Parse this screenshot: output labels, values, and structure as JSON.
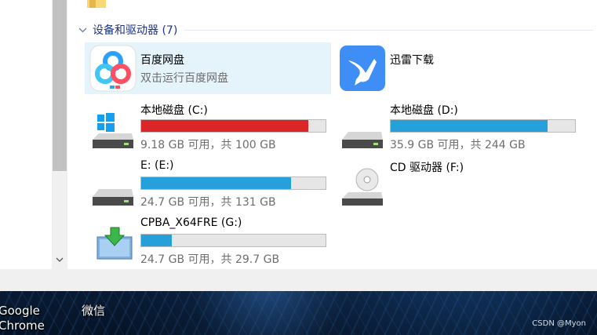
{
  "desktop": {
    "icons": [
      {
        "label_line1": "Google",
        "label_line2": "Chrome"
      },
      {
        "label_line1": "微信"
      }
    ],
    "watermark": "CSDN @Myon⁠"
  },
  "explorer": {
    "group": {
      "title": "设备和驱动器 (7)"
    },
    "apps": [
      {
        "name": "百度网盘",
        "subtitle": "双击运行百度网盘",
        "icon": "baidu-netdisk-icon",
        "selected": true,
        "color": "#2aa1ff"
      },
      {
        "name": "迅雷下载",
        "icon": "xunlei-thunder-icon",
        "selected": false,
        "color": "#3f8ef5"
      }
    ],
    "drives": [
      {
        "name": "本地磁盘 (C:)",
        "free_text": "9.18 GB 可用，共 100 GB",
        "used_fraction": 0.908,
        "bar_color": "#da2626",
        "icon": "windows-drive-icon"
      },
      {
        "name": "本地磁盘 (D:)",
        "free_text": "35.9 GB 可用，共 244 GB",
        "used_fraction": 0.853,
        "bar_color": "#26a0da",
        "icon": "hard-drive-icon"
      },
      {
        "name": "E: (E:)",
        "free_text": "24.7 GB 可用，共 131 GB",
        "used_fraction": 0.811,
        "bar_color": "#26a0da",
        "icon": "hard-drive-icon"
      },
      {
        "name": "CD 驱动器 (F:)",
        "icon": "cd-drive-icon"
      },
      {
        "name": "CPBA_X64FRE (G:)",
        "free_text": "24.7 GB 可用，共 29.7 GB",
        "used_fraction": 0.168,
        "bar_color": "#26a0da",
        "icon": "usb-install-drive-icon"
      }
    ]
  }
}
